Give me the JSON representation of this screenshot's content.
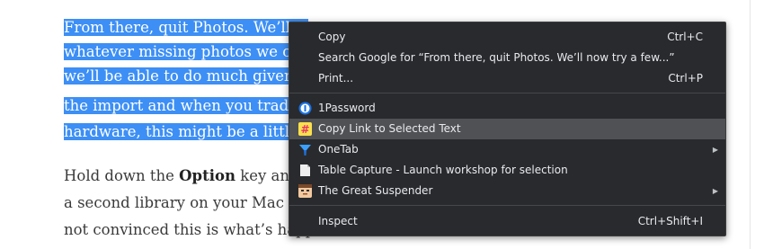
{
  "article": {
    "selected_lines": [
      "From there, quit Photos. We’ll n",
      "whatever missing photos we can",
      "we’ll be able to do much given h",
      "the import and when you traded",
      "hardware, this might be a little"
    ],
    "para2_line1_pre": "Hold down the ",
    "para2_line1_bold": "Option",
    "para2_line1_post": " key and l",
    "para2_line2": "a second library on your Mac th",
    "para2_line3": "not convinced this is what’s happ"
  },
  "context_menu": {
    "copy": {
      "label": "Copy",
      "shortcut": "Ctrl+C"
    },
    "search_google": {
      "label": "Search Google for “From there, quit Photos. We’ll now try a few...”"
    },
    "print": {
      "label": "Print...",
      "shortcut": "Ctrl+P"
    },
    "onepassword": {
      "label": "1Password",
      "icon": "1password-icon"
    },
    "copy_link": {
      "label": "Copy Link to Selected Text",
      "icon": "hash-icon"
    },
    "onetab": {
      "label": "OneTab",
      "icon": "onetab-funnel-icon"
    },
    "table_capture": {
      "label": "Table Capture - Launch workshop for selection",
      "icon": "table-capture-icon"
    },
    "great_suspender": {
      "label": "The Great Suspender",
      "icon": "suspender-face-icon"
    },
    "inspect": {
      "label": "Inspect",
      "shortcut": "Ctrl+Shift+I"
    }
  },
  "colors": {
    "selection": "#3d8ff5",
    "menu_bg": "#292a2d",
    "menu_highlight": "#505154",
    "menu_text": "#e8eaed"
  }
}
